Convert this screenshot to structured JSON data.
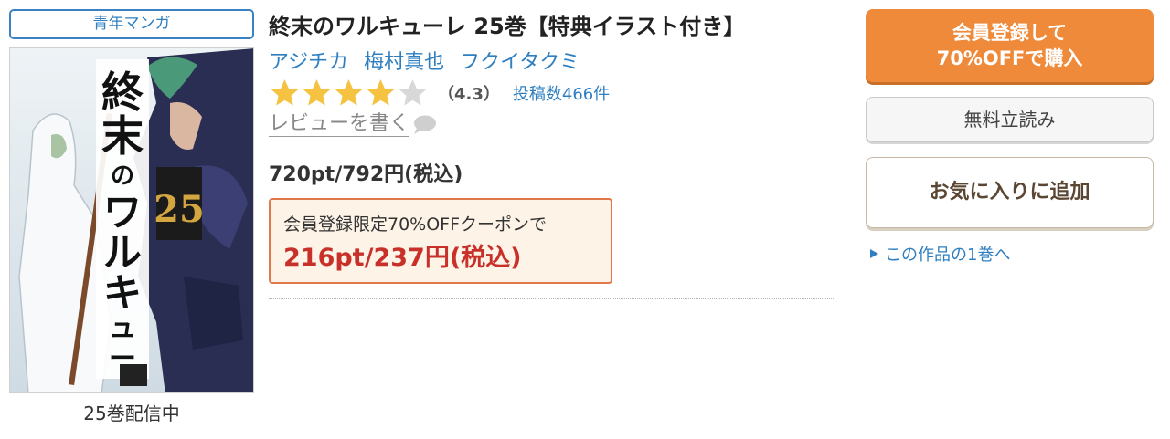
{
  "genre": {
    "label": "青年マンガ"
  },
  "cover": {
    "caption": "25巻配信中",
    "title_text": "終末のワルキューレ",
    "volume_number": "25"
  },
  "product": {
    "title": "終末のワルキューレ 25巻【特典イラスト付き】",
    "authors": [
      "アジチカ",
      "梅村真也",
      "フクイタクミ"
    ],
    "rating": {
      "stars": 4.3,
      "score_text": "（4.3）",
      "review_count_text": "投稿数466件"
    },
    "write_review_label": "レビューを書く",
    "price_text": "720pt/792円(税込)",
    "coupon": {
      "label": "会員登録限定70%OFFクーポンで",
      "price_text": "216pt/237円(税込)"
    }
  },
  "actions": {
    "signup_line1": "会員登録して",
    "signup_line2": "70%OFFで購入",
    "trial_label": "無料立読み",
    "favorite_label": "お気に入りに追加",
    "first_volume_link": "この作品の1巻へ"
  },
  "colors": {
    "accent_blue": "#2f7fc0",
    "signup_orange": "#ee8a39",
    "star_gold": "#f5c242",
    "star_empty": "#d8d8d8",
    "coupon_red": "#c8302a"
  },
  "icons": {
    "star": "star-icon",
    "speech": "speech-bubble-icon",
    "arrow": "triangle-right-icon"
  }
}
